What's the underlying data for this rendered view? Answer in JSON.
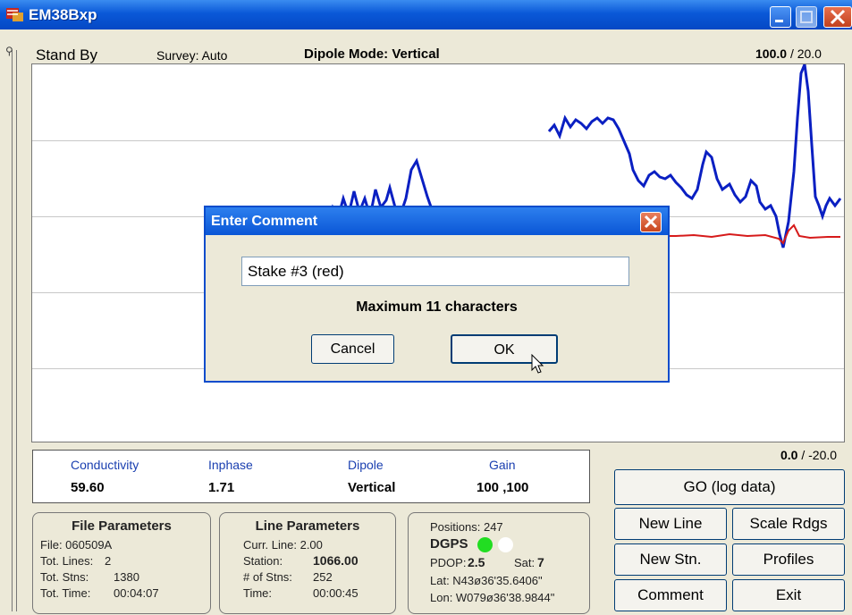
{
  "window": {
    "title": "EM38Bxp"
  },
  "status": {
    "state": "Stand By",
    "survey": "Survey: Auto",
    "dipole_mode": "Dipole Mode: Vertical",
    "scale_top_bold": "100.0",
    "scale_top_rest": "/ 20.0",
    "scale_bottom_bold": "0.0",
    "scale_bottom_rest": "/ -20.0"
  },
  "dialog": {
    "title": "Enter Comment",
    "input_value": "Stake #3 (red)",
    "message": "Maximum 11 characters",
    "cancel_label": "Cancel",
    "ok_label": "OK"
  },
  "readings": {
    "conductivity_label": "Conductivity",
    "conductivity_value": "59.60",
    "inphase_label": "Inphase",
    "inphase_value": "1.71",
    "dipole_label": "Dipole",
    "dipole_value": "Vertical",
    "gain_label": "Gain",
    "gain_value": "100 ,100"
  },
  "file_params": {
    "heading": "File Parameters",
    "file": "File: 060509A",
    "lines_label": "Tot. Lines:",
    "lines_value": "2",
    "stns_label": "Tot. Stns:",
    "stns_value": "1380",
    "time_label": "Tot. Time:",
    "time_value": "00:04:07"
  },
  "line_params": {
    "heading": "Line Parameters",
    "curr_line": "Curr. Line: 2.00",
    "station_label": "Station:",
    "station_value": "1066.00",
    "num_stns_label": "# of Stns:",
    "num_stns_value": "252",
    "time_label": "Time:",
    "time_value": "00:00:45"
  },
  "gps": {
    "positions": "Positions: 247",
    "dgps": "DGPS",
    "pdop_label": "PDOP:",
    "pdop_value": "2.5",
    "sat_label": "Sat:",
    "sat_value": "7",
    "lat": "Lat: N43ø36'35.6406\"",
    "lon": "Lon: W079ø36'38.9844\""
  },
  "buttons": {
    "go": "GO (log data)",
    "new_line": "New Line",
    "scale_rdgs": "Scale Rdgs",
    "new_stn": "New Stn.",
    "profiles": "Profiles",
    "comment": "Comment",
    "exit": "Exit"
  },
  "colors": {
    "conductivity_trace": "#0a1fc2",
    "inphase_trace": "#d61a1a",
    "dgps_on": "#22dd22",
    "dgps_off": "#ffffff"
  }
}
